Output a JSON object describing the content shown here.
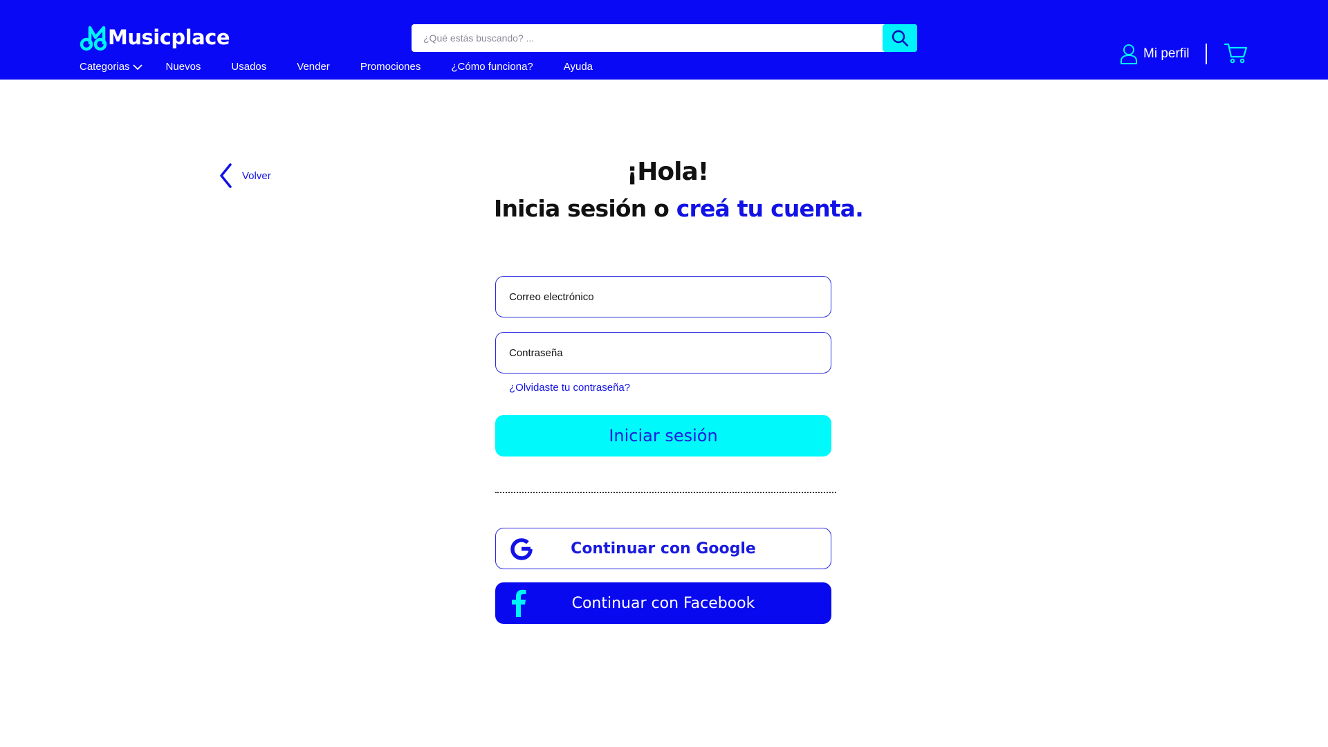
{
  "brand": {
    "name": "Musicplace"
  },
  "colors": {
    "primary": "#0909f6",
    "accent": "#00f2fa",
    "link": "#1212e6"
  },
  "header": {
    "search_placeholder": "¿Qué estás buscando? ...",
    "nav": [
      "Categorias",
      "Nuevos",
      "Usados",
      "Vender",
      "Promociones",
      "¿Cómo funciona?",
      "Ayuda"
    ],
    "profile_label": "Mi perfil"
  },
  "icons": [
    "search-icon",
    "chevron-down-icon",
    "user-icon",
    "cart-icon",
    "chevron-left-icon",
    "google-icon",
    "facebook-icon"
  ],
  "login": {
    "back_label": "Volver",
    "greeting": "¡Hola!",
    "subtitle_prefix": "Inicia sesión o ",
    "subtitle_link": "creá tu cuenta.",
    "email_placeholder": "Correo electrónico",
    "password_placeholder": "Contraseña",
    "forgot_label": "¿Olvidaste tu contraseña?",
    "submit_label": "Iniciar sesión",
    "google_label": "Continuar con Google",
    "facebook_label": "Continuar con Facebook"
  }
}
